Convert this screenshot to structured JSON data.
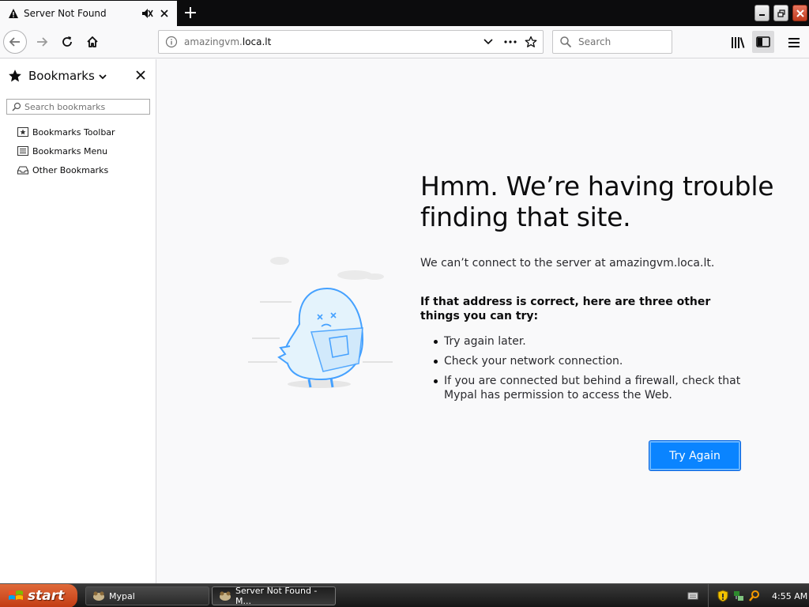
{
  "tab": {
    "title": "Server Not Found"
  },
  "navbar": {
    "url_prefix": "amazingvm.",
    "url_domain": "loca.lt",
    "search_placeholder": "Search"
  },
  "sidebar": {
    "title": "Bookmarks",
    "search_placeholder": "Search bookmarks",
    "items": [
      {
        "label": "Bookmarks Toolbar",
        "icon": "bookmarks-toolbar-icon"
      },
      {
        "label": "Bookmarks Menu",
        "icon": "bookmarks-menu-icon"
      },
      {
        "label": "Other Bookmarks",
        "icon": "other-bookmarks-icon"
      }
    ]
  },
  "error": {
    "title": "Hmm. We’re having trouble finding that site.",
    "description": "We can’t connect to the server at amazingvm.loca.lt.",
    "subtitle": "If that address is correct, here are three other things you can try:",
    "suggestions": [
      "Try again later.",
      "Check your network connection.",
      "If you are connected but behind a firewall, check that Mypal has permission to access the Web."
    ],
    "button_label": "Try Again"
  },
  "taskbar": {
    "start_label": "start",
    "tasks": [
      {
        "label": "Mypal"
      },
      {
        "label": "Server Not Found - M..."
      }
    ],
    "clock": "4:55 AM"
  },
  "colors": {
    "accent": "#0a84ff",
    "start_button": "#c23b13",
    "page_bg": "#f9f9fa"
  }
}
